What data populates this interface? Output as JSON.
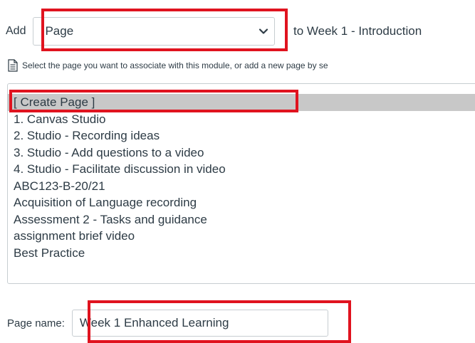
{
  "add_row": {
    "add_label": "Add",
    "selected_type": "Page",
    "to_text": "to Week 1 - Introduction"
  },
  "instruction": {
    "icon": "document-icon",
    "text": "Select the page you want to associate with this module, or add a new page by se"
  },
  "page_list": {
    "items": [
      {
        "label": "[ Create Page ]",
        "selected": true
      },
      {
        "label": "1. Canvas Studio",
        "selected": false
      },
      {
        "label": "2. Studio - Recording ideas",
        "selected": false
      },
      {
        "label": "3. Studio - Add questions to a video",
        "selected": false
      },
      {
        "label": "4. Studio - Facilitate discussion in video",
        "selected": false
      },
      {
        "label": "ABC123-B-20/21",
        "selected": false
      },
      {
        "label": "Acquisition of Language recording",
        "selected": false
      },
      {
        "label": "Assessment 2 - Tasks and guidance",
        "selected": false
      },
      {
        "label": "assignment brief video",
        "selected": false
      },
      {
        "label": "Best Practice",
        "selected": false
      }
    ]
  },
  "page_name": {
    "label": "Page name:",
    "value": "Week 1 Enhanced Learning"
  },
  "colors": {
    "highlight": "#e0131f",
    "selected_row": "#c8c8c8",
    "text": "#2d3b45",
    "border": "#c7cdd1"
  }
}
